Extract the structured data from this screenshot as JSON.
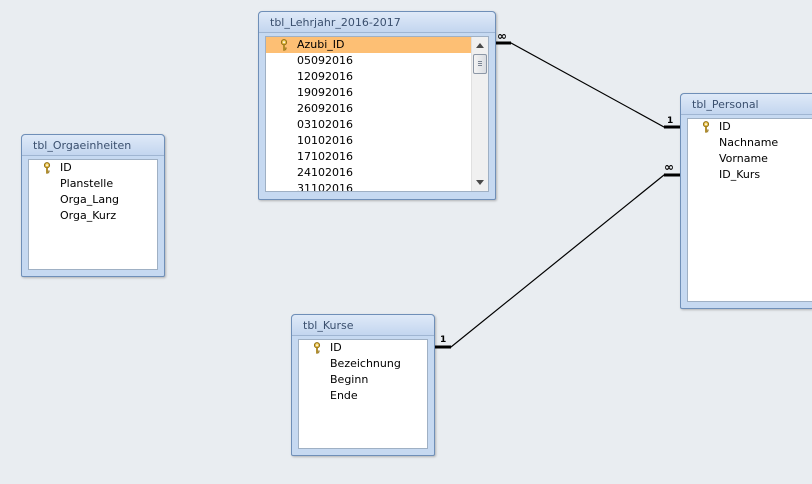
{
  "tables": {
    "orgaeinheiten": {
      "title": "tbl_Orgaeinheiten",
      "fields": [
        "ID",
        "Planstelle",
        "Orga_Lang",
        "Orga_Kurz"
      ]
    },
    "lehrjahr": {
      "title": "tbl_Lehrjahr_2016-2017",
      "fields": [
        "Azubi_ID",
        "05092016",
        "12092016",
        "19092016",
        "26092016",
        "03102016",
        "10102016",
        "17102016",
        "24102016",
        "31102016"
      ],
      "selected_field": "Azubi_ID"
    },
    "personal": {
      "title": "tbl_Personal",
      "fields": [
        "ID",
        "Nachname",
        "Vorname",
        "ID_Kurs"
      ]
    },
    "kurse": {
      "title": "tbl_Kurse",
      "fields": [
        "ID",
        "Bezeichnung",
        "Beginn",
        "Ende"
      ]
    }
  },
  "relationships": {
    "lehrjahr_personal": {
      "many_label": "∞",
      "one_label": "1"
    },
    "kurse_personal": {
      "one_label": "1",
      "many_label": "∞"
    }
  },
  "icons": {
    "primary_key": "key-icon",
    "scroll_up": "arrow-up-icon",
    "scroll_down": "arrow-down-icon"
  },
  "colors": {
    "canvas": "#e9edf1",
    "table_frame": "#c6d9f1",
    "selection": "#fdbf74",
    "line": "#000000"
  }
}
